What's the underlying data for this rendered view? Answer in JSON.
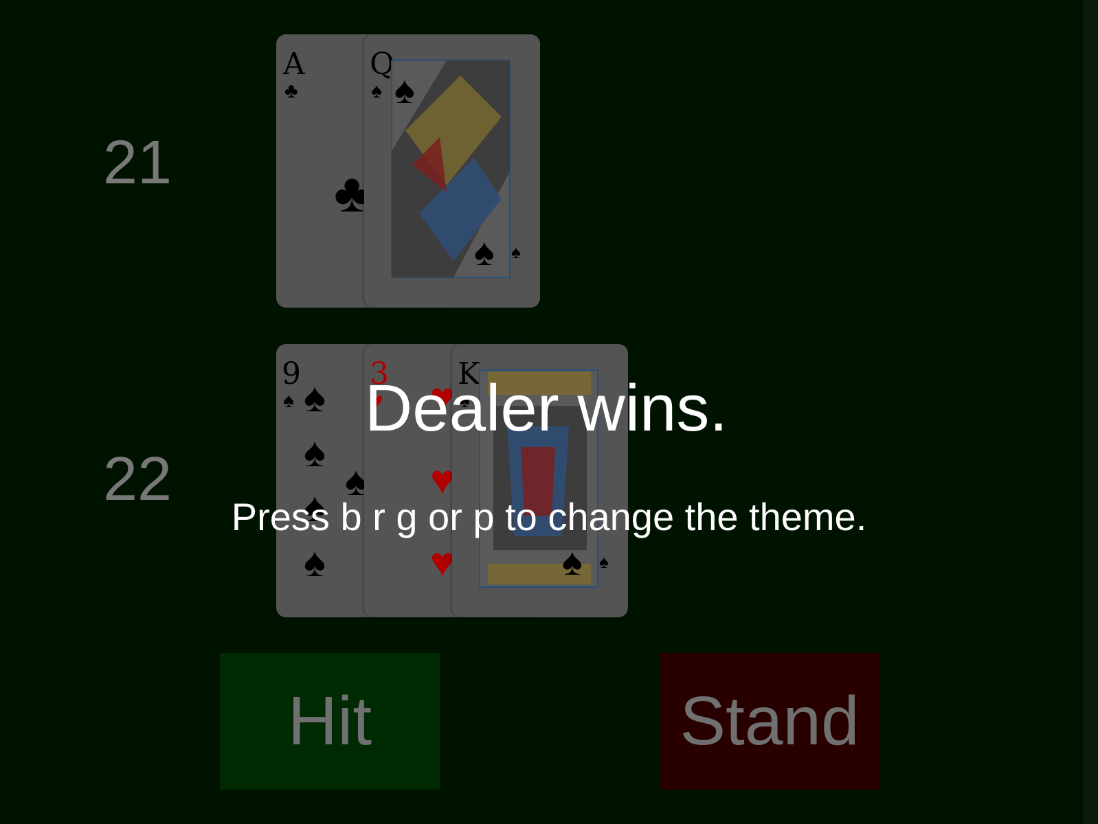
{
  "dealer": {
    "score": "21",
    "cards": [
      {
        "rank": "A",
        "suit": "clubs",
        "color": "#000000"
      },
      {
        "rank": "Q",
        "suit": "spades",
        "color": "#000000"
      }
    ]
  },
  "player": {
    "score": "22",
    "cards": [
      {
        "rank": "9",
        "suit": "spades",
        "color": "#000000"
      },
      {
        "rank": "3",
        "suit": "hearts",
        "color": "#b00000"
      },
      {
        "rank": "K",
        "suit": "spades",
        "color": "#000000"
      }
    ]
  },
  "controls": {
    "hit_label": "Hit",
    "stand_label": "Stand"
  },
  "status": {
    "message": "Dealer wins.",
    "hint": "Press b r g or p to change the theme."
  },
  "colors": {
    "table": "#001300",
    "hit": "#002a02",
    "stand": "#280000",
    "card_face": "#545454"
  }
}
